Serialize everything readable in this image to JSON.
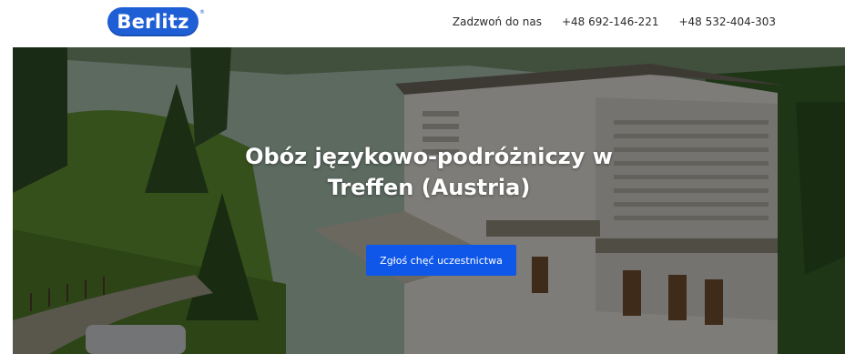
{
  "header": {
    "logo_text": "Berlitz",
    "contact_label": "Zadzwoń do nas",
    "phone_1": "+48 692-146-221",
    "phone_2": "+48 532-404-303"
  },
  "hero": {
    "title": "Obóz językowo-podróżniczy w Treffen (Austria)",
    "cta_label": "Zgłoś chęć uczestnictwa",
    "background_image": "alpine-hotel-photo"
  },
  "colors": {
    "brand_blue": "#1f5fd6",
    "cta_blue": "#0f57e8",
    "text_dark": "#2a2a2a"
  }
}
